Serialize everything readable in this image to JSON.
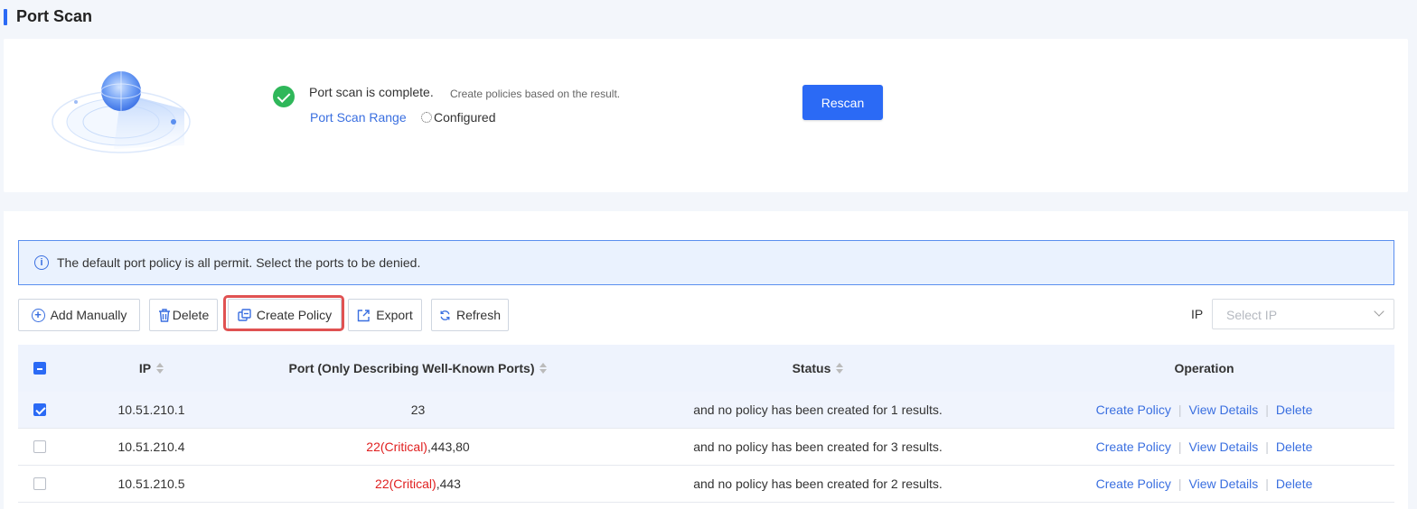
{
  "page": {
    "title": "Port Scan"
  },
  "scan": {
    "status": "Port scan is complete.",
    "hint": "Create policies based on the result.",
    "range_link": "Port Scan Range",
    "configured": "Configured",
    "rescan_label": "Rescan"
  },
  "banner": {
    "text": "The default port policy is all permit. Select the ports to be denied."
  },
  "toolbar": {
    "add_manually": "Add Manually",
    "delete": "Delete",
    "create_policy": "Create Policy",
    "export": "Export",
    "refresh": "Refresh",
    "ip_label": "IP",
    "ip_placeholder": "Select IP"
  },
  "table": {
    "headers": {
      "ip": "IP",
      "port": "Port (Only Describing Well-Known Ports)",
      "status": "Status",
      "operation": "Operation"
    },
    "rows": [
      {
        "ip": "10.51.210.1",
        "port_critical": "",
        "port_rest": "23",
        "status": "and no policy has been created for 1 results.",
        "checked": true
      },
      {
        "ip": "10.51.210.4",
        "port_critical": "22(Critical)",
        "port_rest": ",443,80",
        "status": "and no policy has been created for 3 results.",
        "checked": false
      },
      {
        "ip": "10.51.210.5",
        "port_critical": "22(Critical)",
        "port_rest": ",443",
        "status": "and no policy has been created for 2 results.",
        "checked": false
      }
    ],
    "operations": {
      "create": "Create Policy",
      "view": "View Details",
      "delete": "Delete"
    }
  },
  "colors": {
    "accent": "#2b6af5",
    "critical": "#e02020",
    "success": "#2fb75a",
    "highlight": "#e05252"
  }
}
